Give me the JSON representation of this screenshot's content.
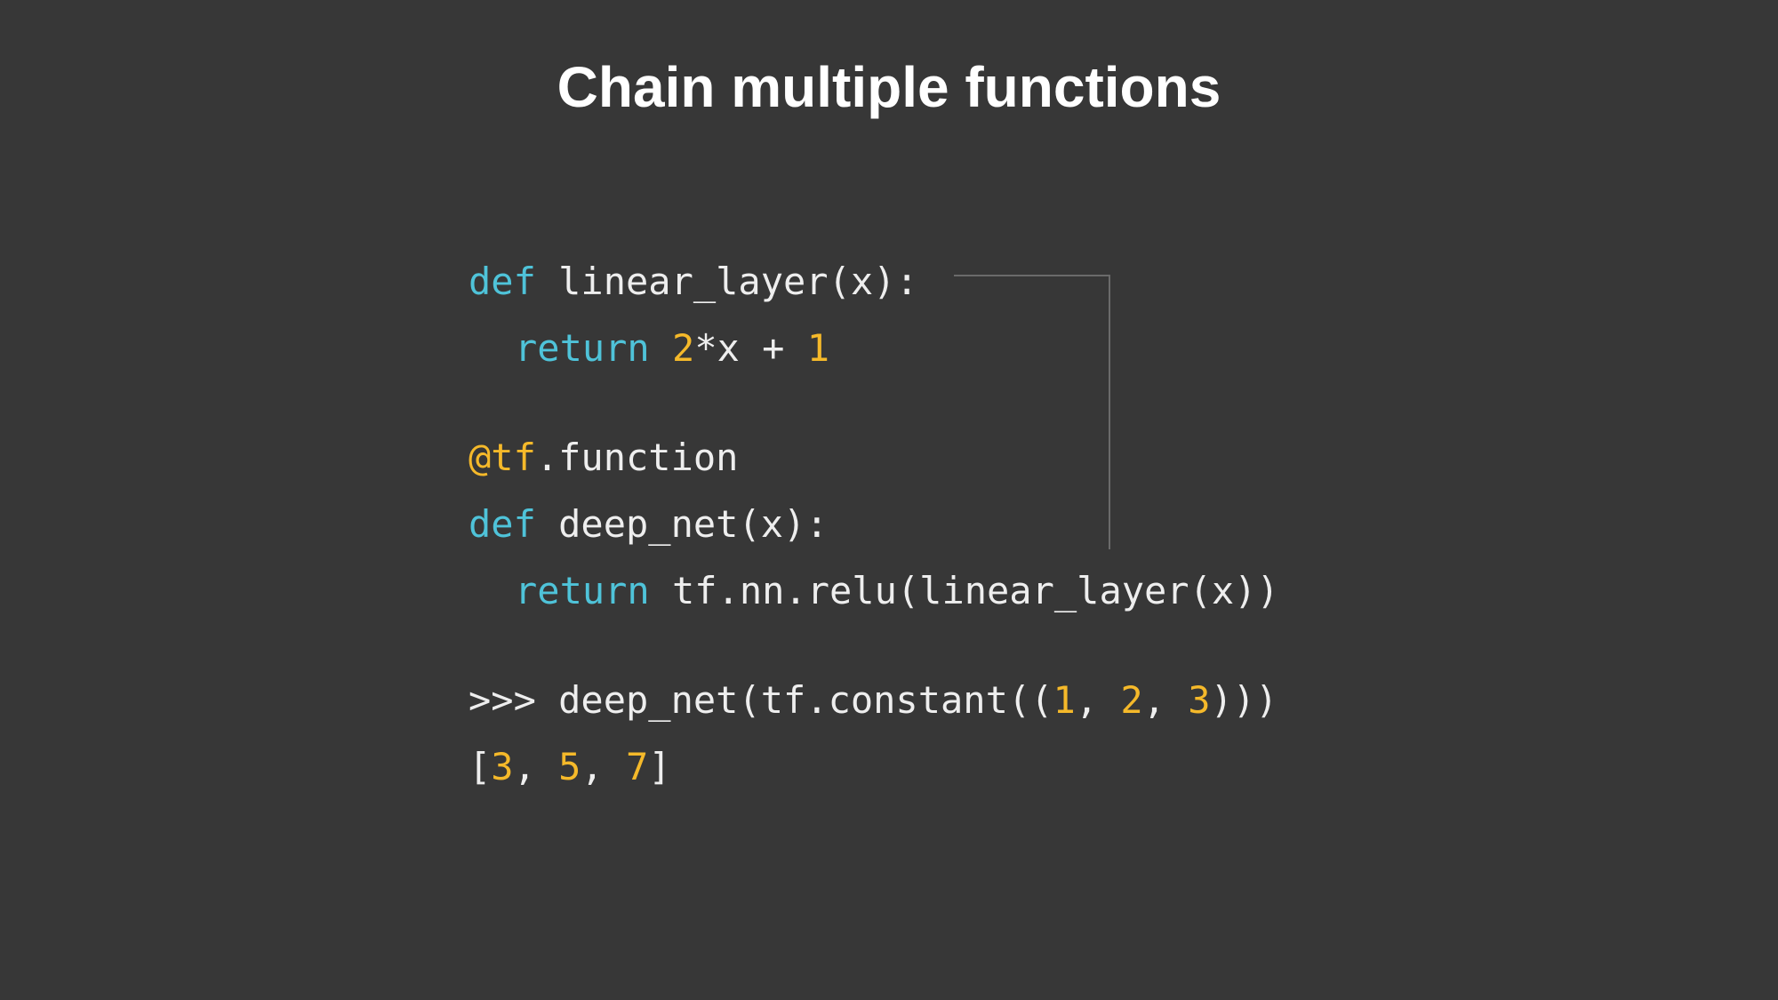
{
  "slide": {
    "title": "Chain multiple functions"
  },
  "code": {
    "line1": {
      "kw": "def",
      "rest": " linear_layer(x):"
    },
    "line2": {
      "kw": "return",
      "sp": " ",
      "n1": "2",
      "mid": "*x + ",
      "n2": "1"
    },
    "line3": {
      "dec": "@tf",
      "rest": ".function"
    },
    "line4": {
      "kw": "def",
      "rest": " deep_net(x):"
    },
    "line5": {
      "kw": "return",
      "rest": " tf.nn.relu(linear_layer(x))"
    },
    "line6": {
      "pre": ">>> deep_net(tf.constant((",
      "n1": "1",
      "s1": ", ",
      "n2": "2",
      "s2": ", ",
      "n3": "3",
      "post": ")))"
    },
    "line7": {
      "pre": "[",
      "n1": "3",
      "s1": ", ",
      "n2": "5",
      "s2": ", ",
      "n3": "7",
      "post": "]"
    }
  },
  "colors": {
    "background": "#373737",
    "keyword": "#4fc3d9",
    "number": "#f5b92a",
    "text": "#eeeeee",
    "connector": "#6a6a6a"
  }
}
